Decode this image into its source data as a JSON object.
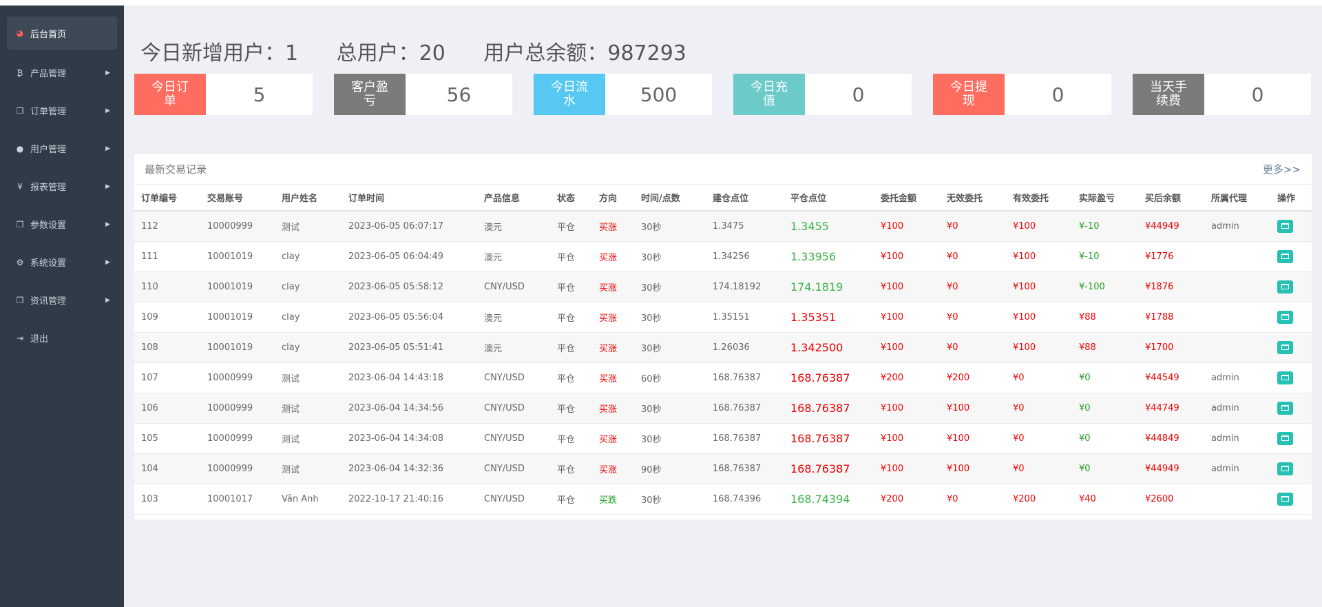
{
  "sidebar": {
    "items": [
      {
        "label": "后台首页",
        "icon": "dashboard-icon",
        "glyph": "◕",
        "active": true,
        "arrow": false
      },
      {
        "label": "产品管理",
        "icon": "bitcoin-icon",
        "glyph": "₿",
        "active": false,
        "arrow": true
      },
      {
        "label": "订单管理",
        "icon": "copy-icon",
        "glyph": "❐",
        "active": false,
        "arrow": true
      },
      {
        "label": "用户管理",
        "icon": "user-icon",
        "glyph": "●",
        "active": false,
        "arrow": true
      },
      {
        "label": "报表管理",
        "icon": "yen-icon",
        "glyph": "¥",
        "active": false,
        "arrow": true
      },
      {
        "label": "参数设置",
        "icon": "copy-icon",
        "glyph": "❐",
        "active": false,
        "arrow": true
      },
      {
        "label": "系统设置",
        "icon": "gears-icon",
        "glyph": "⚙",
        "active": false,
        "arrow": true
      },
      {
        "label": "资讯管理",
        "icon": "copy-icon",
        "glyph": "❐",
        "active": false,
        "arrow": true
      },
      {
        "label": "退出",
        "icon": "sign-out-icon",
        "glyph": "⇥",
        "active": false,
        "arrow": false
      }
    ],
    "arrow_glyph": "▶"
  },
  "summary": {
    "new_users": "今日新增用户：1",
    "total_users": "总用户：20",
    "total_balance": "用户总余额：987293"
  },
  "stats": [
    {
      "label": "今日订单",
      "value": "5",
      "color": "#ff6c60"
    },
    {
      "label": "客户盈亏",
      "value": "56",
      "color": "#7b7b7b"
    },
    {
      "label": "今日流水",
      "value": "500",
      "color": "#57c8f2"
    },
    {
      "label": "今日充值",
      "value": "0",
      "color": "#6ccac9"
    },
    {
      "label": "今日提现",
      "value": "0",
      "color": "#ff6c60"
    },
    {
      "label": "当天手续费",
      "value": "0",
      "color": "#7b7b7b"
    }
  ],
  "panel": {
    "title": "最新交易记录",
    "more": "更多>>",
    "columns": [
      "订单编号",
      "交易账号",
      "用户姓名",
      "订单时间",
      "产品信息",
      "状态",
      "方向",
      "时间/点数",
      "建仓点位",
      "平仓点位",
      "委托金额",
      "无效委托",
      "有效委托",
      "实际盈亏",
      "买后余额",
      "所属代理",
      "操作"
    ],
    "rows": [
      {
        "id": "112",
        "account": "10000999",
        "name": "测试",
        "time": "2023-06-05 06:07:17",
        "product": "澳元",
        "status": "平仓",
        "direction": "买涨",
        "duration": "30秒",
        "open": "1.3475",
        "close": "1.3455",
        "close_trend": "down",
        "amount": "¥100",
        "invalid": "¥0",
        "valid": "¥100",
        "pnl": "¥-10",
        "pnl_trend": "loss",
        "balance": "¥44949",
        "agent": "admin"
      },
      {
        "id": "111",
        "account": "10001019",
        "name": "clay",
        "time": "2023-06-05 06:04:49",
        "product": "澳元",
        "status": "平仓",
        "direction": "买涨",
        "duration": "30秒",
        "open": "1.34256",
        "close": "1.33956",
        "close_trend": "down",
        "amount": "¥100",
        "invalid": "¥0",
        "valid": "¥100",
        "pnl": "¥-10",
        "pnl_trend": "loss",
        "balance": "¥1776",
        "agent": ""
      },
      {
        "id": "110",
        "account": "10001019",
        "name": "clay",
        "time": "2023-06-05 05:58:12",
        "product": "CNY/USD",
        "status": "平仓",
        "direction": "买涨",
        "duration": "30秒",
        "open": "174.18192",
        "close": "174.1819",
        "close_trend": "down",
        "amount": "¥100",
        "invalid": "¥0",
        "valid": "¥100",
        "pnl": "¥-100",
        "pnl_trend": "loss",
        "balance": "¥1876",
        "agent": ""
      },
      {
        "id": "109",
        "account": "10001019",
        "name": "clay",
        "time": "2023-06-05 05:56:04",
        "product": "澳元",
        "status": "平仓",
        "direction": "买涨",
        "duration": "30秒",
        "open": "1.35151",
        "close": "1.35351",
        "close_trend": "up",
        "amount": "¥100",
        "invalid": "¥0",
        "valid": "¥100",
        "pnl": "¥88",
        "pnl_trend": "gain",
        "balance": "¥1788",
        "agent": ""
      },
      {
        "id": "108",
        "account": "10001019",
        "name": "clay",
        "time": "2023-06-05 05:51:41",
        "product": "澳元",
        "status": "平仓",
        "direction": "买涨",
        "duration": "30秒",
        "open": "1.26036",
        "close": "1.342500",
        "close_trend": "up",
        "amount": "¥100",
        "invalid": "¥0",
        "valid": "¥100",
        "pnl": "¥88",
        "pnl_trend": "gain",
        "balance": "¥1700",
        "agent": ""
      },
      {
        "id": "107",
        "account": "10000999",
        "name": "测试",
        "time": "2023-06-04 14:43:18",
        "product": "CNY/USD",
        "status": "平仓",
        "direction": "买涨",
        "duration": "60秒",
        "open": "168.76387",
        "close": "168.76387",
        "close_trend": "up",
        "amount": "¥200",
        "invalid": "¥200",
        "valid": "¥0",
        "pnl": "¥0",
        "pnl_trend": "loss",
        "balance": "¥44549",
        "agent": "admin"
      },
      {
        "id": "106",
        "account": "10000999",
        "name": "测试",
        "time": "2023-06-04 14:34:56",
        "product": "CNY/USD",
        "status": "平仓",
        "direction": "买涨",
        "duration": "30秒",
        "open": "168.76387",
        "close": "168.76387",
        "close_trend": "up",
        "amount": "¥100",
        "invalid": "¥100",
        "valid": "¥0",
        "pnl": "¥0",
        "pnl_trend": "loss",
        "balance": "¥44749",
        "agent": "admin"
      },
      {
        "id": "105",
        "account": "10000999",
        "name": "测试",
        "time": "2023-06-04 14:34:08",
        "product": "CNY/USD",
        "status": "平仓",
        "direction": "买涨",
        "duration": "30秒",
        "open": "168.76387",
        "close": "168.76387",
        "close_trend": "up",
        "amount": "¥100",
        "invalid": "¥100",
        "valid": "¥0",
        "pnl": "¥0",
        "pnl_trend": "loss",
        "balance": "¥44849",
        "agent": "admin"
      },
      {
        "id": "104",
        "account": "10000999",
        "name": "测试",
        "time": "2023-06-04 14:32:36",
        "product": "CNY/USD",
        "status": "平仓",
        "direction": "买涨",
        "duration": "90秒",
        "open": "168.76387",
        "close": "168.76387",
        "close_trend": "up",
        "amount": "¥100",
        "invalid": "¥100",
        "valid": "¥0",
        "pnl": "¥0",
        "pnl_trend": "loss",
        "balance": "¥44949",
        "agent": "admin"
      },
      {
        "id": "103",
        "account": "10001017",
        "name": "Vân Anh",
        "time": "2022-10-17 21:40:16",
        "product": "CNY/USD",
        "status": "平仓",
        "direction": "买跌",
        "duration": "30秒",
        "open": "168.74396",
        "close": "168.74394",
        "close_trend": "down",
        "amount": "¥200",
        "invalid": "¥0",
        "valid": "¥200",
        "pnl": "¥40",
        "pnl_trend": "gain",
        "balance": "¥2600",
        "agent": ""
      }
    ]
  }
}
